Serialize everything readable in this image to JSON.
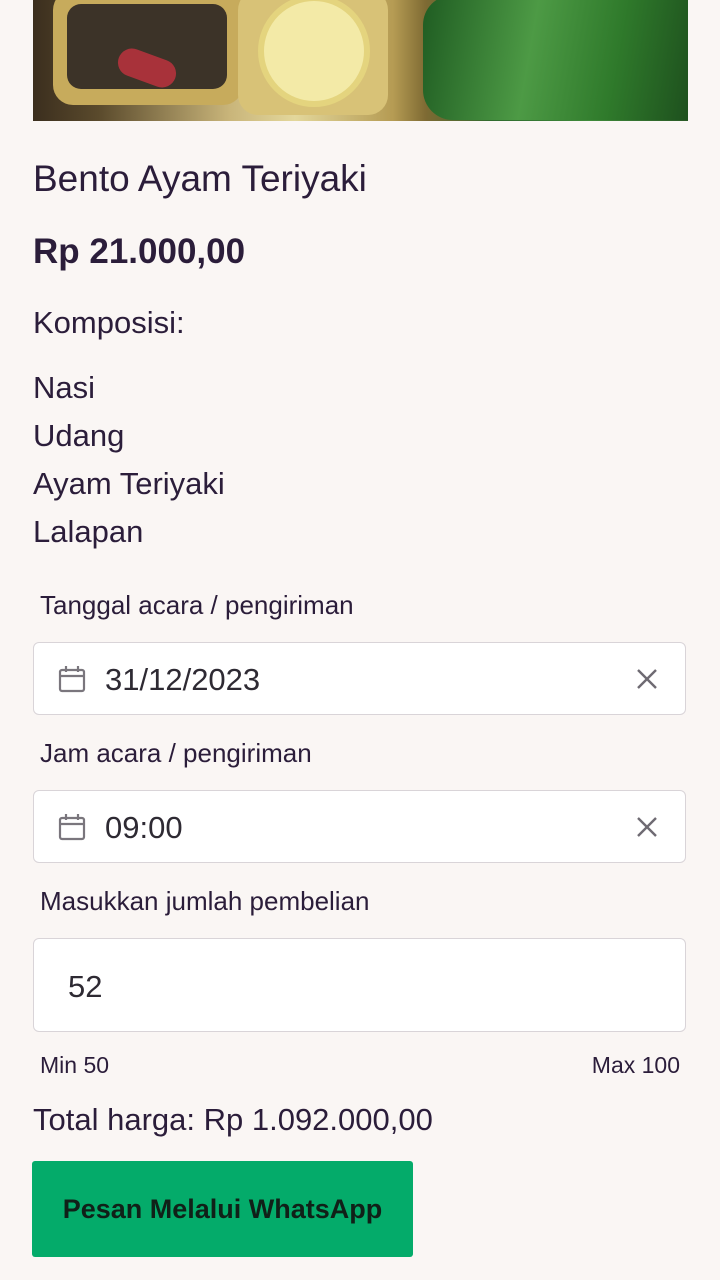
{
  "product": {
    "title": "Bento Ayam Teriyaki",
    "price": "Rp 21.000,00",
    "composition_label": "Komposisi:",
    "composition": [
      "Nasi",
      "Udang",
      "Ayam Teriyaki",
      "Lalapan"
    ]
  },
  "form": {
    "date_label": "Tanggal acara / pengiriman",
    "date_value": "31/12/2023",
    "time_label": "Jam acara / pengiriman",
    "time_value": "09:00",
    "qty_label": "Masukkan jumlah pembelian",
    "qty_value": "52",
    "min_hint": "Min 50",
    "max_hint": "Max 100"
  },
  "total_text": "Total harga: Rp 1.092.000,00",
  "order_button": "Pesan Melalui WhatsApp",
  "colors": {
    "background": "#faf6f4",
    "text": "#2b1d3a",
    "button": "#04ab6a"
  },
  "icons": {
    "date_icon": "calendar-icon",
    "time_icon": "calendar-icon",
    "clear_icon": "close-icon"
  }
}
